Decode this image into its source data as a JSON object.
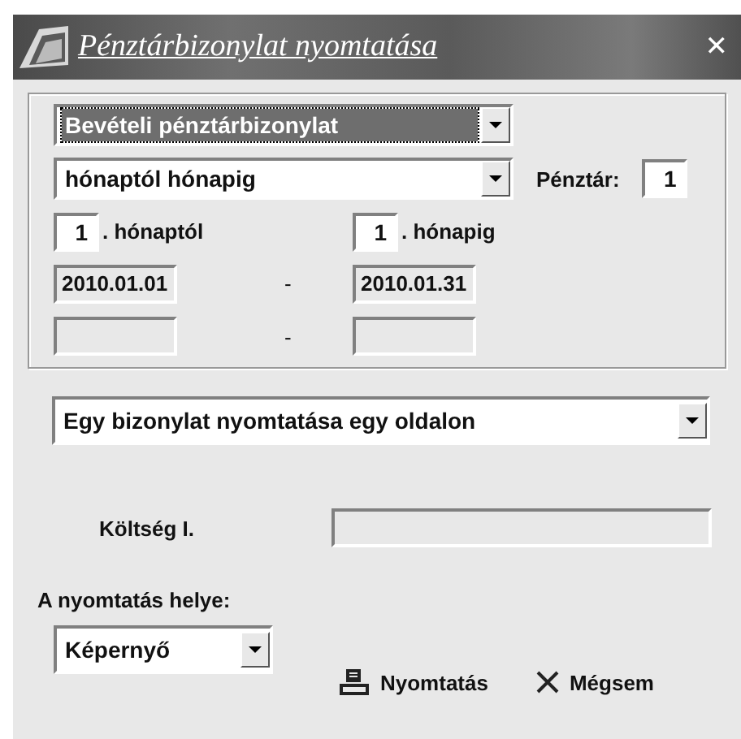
{
  "window": {
    "title": "Pénztárbizonylat nyomtatása",
    "close": "✕"
  },
  "document_type": {
    "value": "Bevételi pénztárbizonylat",
    "focused": true
  },
  "period_mode": {
    "value": "hónaptól hónapig",
    "focused": false
  },
  "cash_desk": {
    "label": "Pénztár:",
    "value": "1"
  },
  "month_from": {
    "value": "1",
    "label": ". hónaptól"
  },
  "month_to": {
    "value": "1",
    "label": ". hónapig"
  },
  "date_separators": [
    "-",
    "-"
  ],
  "date_from": "2010.01.01",
  "date_to": "2010.01.31",
  "print_layout": {
    "value": "Egy bizonylat nyomtatása egy oldalon",
    "focused": false
  },
  "cost": {
    "label": "Költség I."
  },
  "destination": {
    "label": "A nyomtatás helye:",
    "value": "Képernyő",
    "focused": false
  },
  "buttons": [
    {
      "kind": "print",
      "label": "Nyomtatás"
    },
    {
      "kind": "cancel",
      "label": "Mégsem"
    }
  ]
}
